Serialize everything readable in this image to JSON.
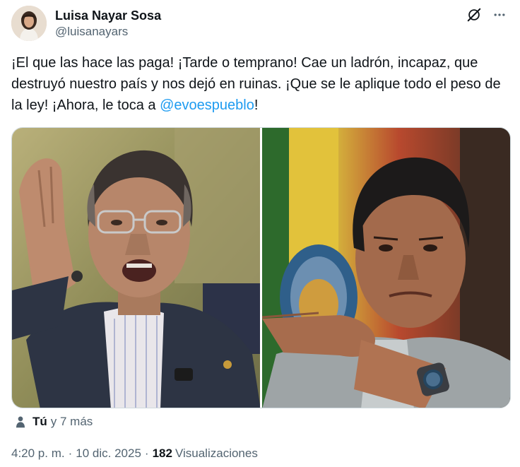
{
  "author": {
    "display_name": "Luisa Nayar Sosa",
    "handle": "@luisanayars",
    "avatar_icon": "avatar-photo"
  },
  "header_actions": {
    "grok_icon": "grok-icon",
    "more_icon": "more-horizontal-icon"
  },
  "tweet": {
    "text_before_mention": "¡El que las hace las paga! ¡Tarde o temprano! Cae un ladrón, incapaz, que destruyó nuestro país y nos dejó en ruinas. ¡Que se le aplique todo el peso de la ley! ¡Ahora, le toca a ",
    "mention": "@evoespueblo",
    "text_after_mention": "!"
  },
  "media": {
    "photos": [
      "photo-left",
      "photo-right"
    ]
  },
  "tagged": {
    "icon": "person-icon",
    "you_label": "Tú",
    "others_label": "y 7 más"
  },
  "meta": {
    "time": "4:20 p. m.",
    "separator": "·",
    "date": "10 dic. 2025",
    "views_count": "182",
    "views_label": "Visualizaciones"
  },
  "colors": {
    "text": "#0f1419",
    "secondary": "#536471",
    "link": "#1d9bf0",
    "border": "#cfd9de"
  }
}
